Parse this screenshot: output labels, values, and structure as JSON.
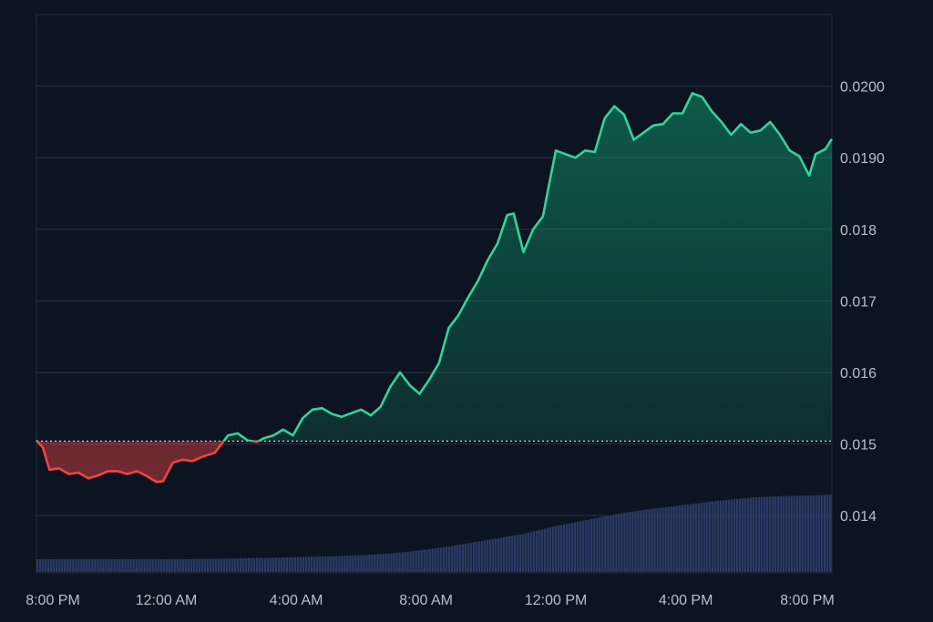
{
  "chart_data": {
    "type": "area",
    "title": "",
    "xlabel": "",
    "ylabel": "",
    "x_ticks": [
      "8:00 PM",
      "12:00 AM",
      "4:00 AM",
      "8:00 AM",
      "12:00 PM",
      "4:00 PM",
      "8:00 PM"
    ],
    "y_ticks": [
      "0.014",
      "0.015",
      "0.016",
      "0.017",
      "0.018",
      "0.0190",
      "0.0200"
    ],
    "ylim": [
      0.0132,
      0.021
    ],
    "x_hours": [
      0,
      24.5
    ],
    "baseline": 0.01504,
    "colors": {
      "up": "#34d399",
      "down": "#ef4444",
      "volume": "#2b3a66",
      "grid": "#2a3344",
      "background": "#0d1421"
    },
    "grid": true,
    "series": [
      {
        "x": [
          0,
          0.2,
          0.4,
          0.7,
          1,
          1.3,
          1.6,
          1.9,
          2.2,
          2.5,
          2.8,
          3.1,
          3.4,
          3.7,
          3.9,
          4.2,
          4.5,
          4.8,
          5.1,
          5.5,
          5.9,
          6.2,
          6.5,
          6.8,
          7,
          7.3,
          7.6,
          7.9,
          8.2,
          8.5,
          8.8,
          9.1,
          9.4,
          9.7,
          10,
          10.3,
          10.6,
          10.9,
          11.2,
          11.5,
          11.8,
          12.1,
          12.4,
          12.7,
          13,
          13.3,
          13.6,
          13.9,
          14.2,
          14.5,
          14.7,
          15,
          15.3,
          15.6,
          15.8,
          16,
          16.3,
          16.6,
          16.9,
          17.2,
          17.5,
          17.8,
          18.1,
          18.4,
          18.7,
          19,
          19.3,
          19.6,
          19.9,
          20.2,
          20.5,
          20.8,
          21.1,
          21.4,
          21.7,
          22,
          22.3,
          22.6,
          22.9,
          23.2,
          23.5,
          23.8,
          24,
          24.3,
          24.5
        ],
        "y": [
          0.01505,
          0.01495,
          0.01464,
          0.01466,
          0.01458,
          0.0146,
          0.01452,
          0.01456,
          0.01462,
          0.01462,
          0.01458,
          0.01462,
          0.01455,
          0.01447,
          0.01448,
          0.01474,
          0.01478,
          0.01476,
          0.01482,
          0.01488,
          0.01512,
          0.01515,
          0.01505,
          0.01503,
          0.01508,
          0.01512,
          0.0152,
          0.01512,
          0.01536,
          0.01548,
          0.0155,
          0.01542,
          0.01538,
          0.01543,
          0.01548,
          0.0154,
          0.01552,
          0.0158,
          0.016,
          0.01582,
          0.0157,
          0.0159,
          0.01613,
          0.01662,
          0.0168,
          0.01705,
          0.01728,
          0.01757,
          0.0178,
          0.0182,
          0.01822,
          0.01768,
          0.018,
          0.01818,
          0.01865,
          0.0191,
          0.01905,
          0.019,
          0.0191,
          0.01908,
          0.01955,
          0.01972,
          0.0196,
          0.01925,
          0.01935,
          0.01945,
          0.01947,
          0.01962,
          0.01962,
          0.0199,
          0.01985,
          0.01965,
          0.0195,
          0.01932,
          0.01947,
          0.01935,
          0.01938,
          0.0195,
          0.01932,
          0.0191,
          0.01902,
          0.01875,
          0.01905,
          0.01912,
          0.01926
        ]
      }
    ],
    "volume": {
      "x": [
        0,
        1,
        2,
        3,
        4,
        5,
        6,
        7,
        8,
        9,
        10,
        11,
        12,
        13,
        14,
        15,
        16,
        17,
        18,
        19,
        20,
        21,
        22,
        23,
        24,
        24.5
      ],
      "values": [
        0.0,
        0.0,
        -0.05,
        -0.05,
        -0.02,
        0.02,
        0.08,
        0.15,
        0.25,
        0.35,
        0.5,
        0.75,
        1.2,
        1.8,
        2.5,
        3.2,
        4.2,
        5.0,
        5.8,
        6.4,
        6.9,
        7.4,
        7.8,
        8.0,
        8.1,
        8.2
      ]
    }
  }
}
